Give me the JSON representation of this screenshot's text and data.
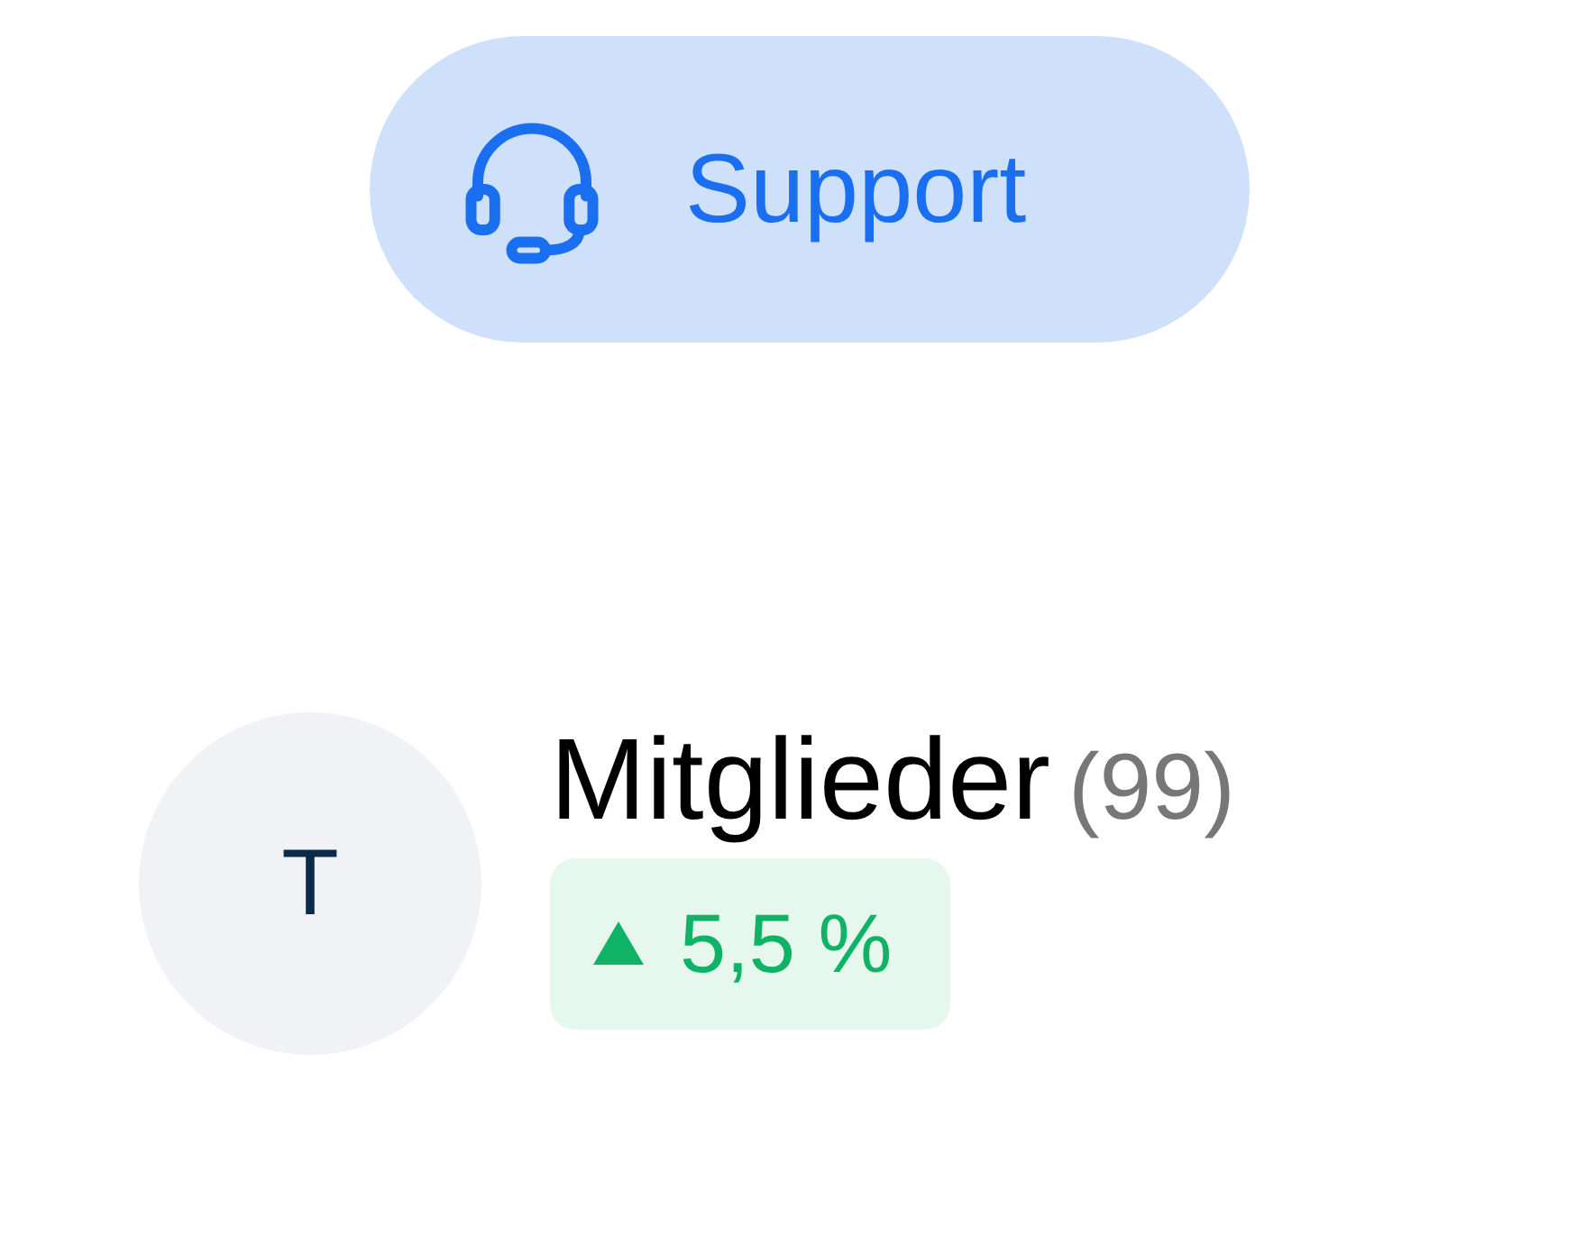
{
  "support_button": {
    "label": "Support"
  },
  "group": {
    "avatar_initial": "T",
    "title": "Mitglieder",
    "count": "(99)",
    "trend": {
      "up": true,
      "value": "5,5 %"
    }
  }
}
